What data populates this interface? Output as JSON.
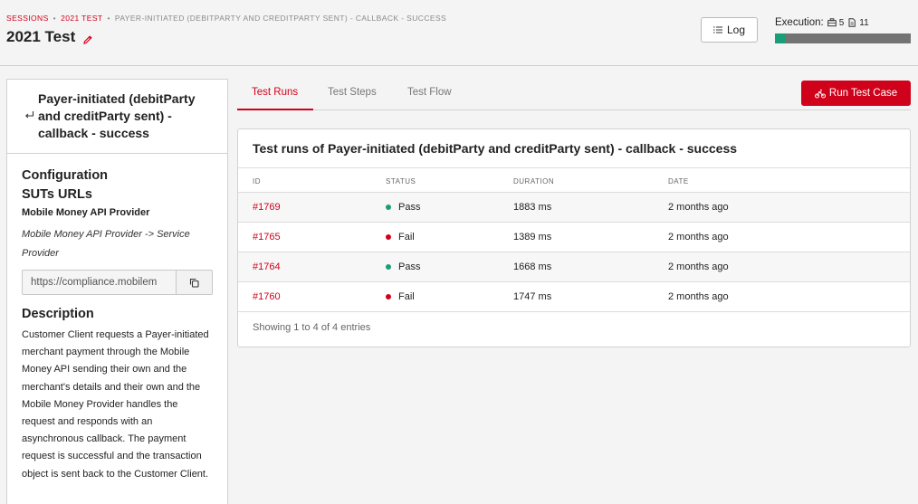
{
  "breadcrumb": {
    "sessions": "SESSIONS",
    "test": "2021 TEST",
    "current": "PAYER-INITIATED (DEBITPARTY AND CREDITPARTY SENT) - CALLBACK - SUCCESS"
  },
  "page_title": "2021 Test",
  "header": {
    "log_label": "Log",
    "execution_label": "Execution:",
    "execution_runs": "5",
    "execution_steps": "11",
    "progress": 0.08
  },
  "sidebar": {
    "title": "Payer-initiated (debitParty and creditParty sent) - callback - success",
    "configuration_heading": "Configuration",
    "suts_heading": "SUTs URLs",
    "provider_name": "Mobile Money API Provider",
    "provider_path": "Mobile Money API Provider -> Service Provider",
    "url_value": "https://compliance.mobilem",
    "description_heading": "Description",
    "description": "Customer Client requests a Payer-initiated merchant payment through the Mobile Money API sending their own and the merchant's details and their own and the Mobile Money Provider handles the request and responds with an asynchronous callback. The payment request is successful and the transaction object is sent back to the Customer Client."
  },
  "tabs": [
    {
      "label": "Test Runs"
    },
    {
      "label": "Test Steps"
    },
    {
      "label": "Test Flow"
    }
  ],
  "run_button_label": "Run Test Case",
  "card": {
    "title": "Test runs of Payer-initiated (debitParty and creditParty sent) - callback - success",
    "columns": [
      "ID",
      "STATUS",
      "DURATION",
      "DATE"
    ],
    "rows": [
      {
        "id": "#1769",
        "status": "Pass",
        "duration": "1883 ms",
        "date": "2 months ago"
      },
      {
        "id": "#1765",
        "status": "Fail",
        "duration": "1389 ms",
        "date": "2 months ago"
      },
      {
        "id": "#1764",
        "status": "Pass",
        "duration": "1668 ms",
        "date": "2 months ago"
      },
      {
        "id": "#1760",
        "status": "Fail",
        "duration": "1747 ms",
        "date": "2 months ago"
      }
    ],
    "footer": "Showing 1 to 4 of 4 entries"
  },
  "colors": {
    "accent": "#d0021b",
    "pass": "#1a9e78",
    "fail": "#d0021b"
  }
}
